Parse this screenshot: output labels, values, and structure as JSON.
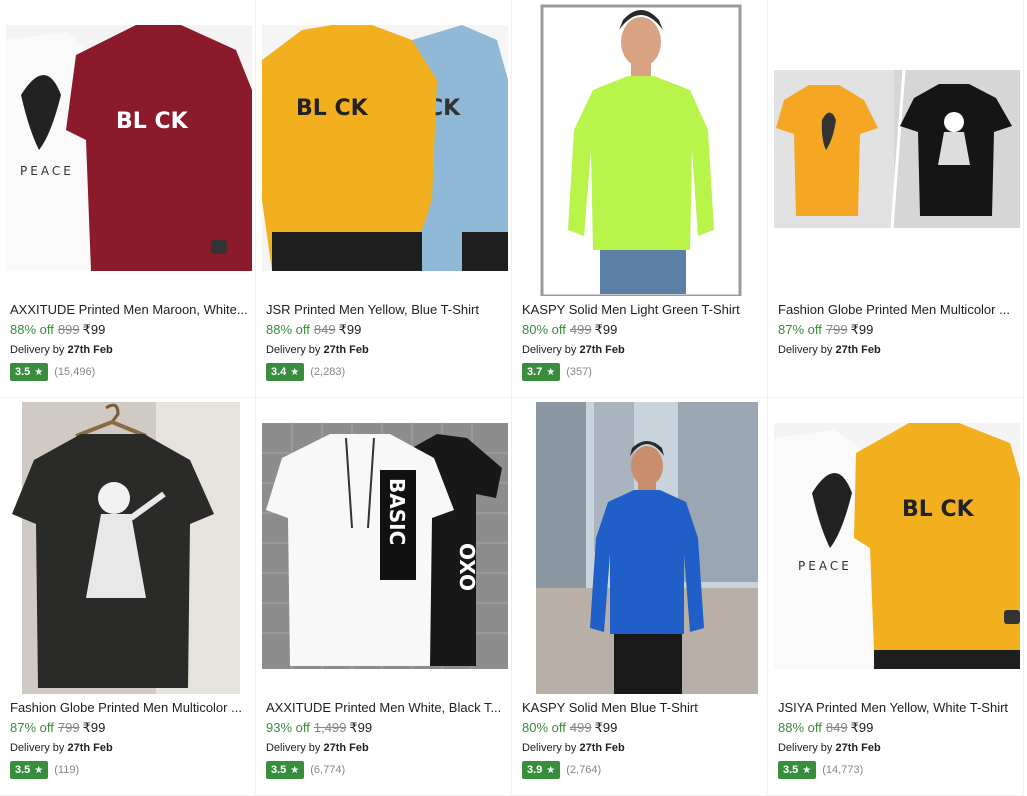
{
  "products": [
    {
      "title": "AXXITUDE Printed Men Maroon, White...",
      "discount": "88% off",
      "mrp": "899",
      "price": "₹99",
      "delivery_prefix": "Delivery by",
      "delivery_date": "27th Feb",
      "rating": "3.5",
      "reviews": "(15,496)",
      "print_text_1": "PEACE",
      "print_text_2": "BL CK"
    },
    {
      "title": "JSR Printed Men Yellow, Blue T-Shirt",
      "discount": "88% off",
      "mrp": "849",
      "price": "₹99",
      "delivery_prefix": "Delivery by",
      "delivery_date": "27th Feb",
      "rating": "3.4",
      "reviews": "(2,283)",
      "print_text_1": "BL CK",
      "print_text_2": "CK"
    },
    {
      "title": "KASPY Solid Men Light Green T-Shirt",
      "discount": "80% off",
      "mrp": "499",
      "price": "₹99",
      "delivery_prefix": "Delivery by",
      "delivery_date": "27th Feb",
      "rating": "3.7",
      "reviews": "(357)"
    },
    {
      "title": "Fashion Globe Printed Men Multicolor ...",
      "discount": "87% off",
      "mrp": "799",
      "price": "₹99",
      "delivery_prefix": "Delivery by",
      "delivery_date": "27th Feb",
      "rating": "",
      "reviews": ""
    },
    {
      "title": "Fashion Globe Printed Men Multicolor ...",
      "discount": "87% off",
      "mrp": "799",
      "price": "₹99",
      "delivery_prefix": "Delivery by",
      "delivery_date": "27th Feb",
      "rating": "3.5",
      "reviews": "(119)"
    },
    {
      "title": "AXXITUDE Printed Men White, Black T...",
      "discount": "93% off",
      "mrp": "1,499",
      "price": "₹99",
      "delivery_prefix": "Delivery by",
      "delivery_date": "27th Feb",
      "rating": "3.5",
      "reviews": "(6,774)",
      "print_text_1": "BASIC",
      "print_text_2": "OXO"
    },
    {
      "title": "KASPY Solid Men Blue T-Shirt",
      "discount": "80% off",
      "mrp": "499",
      "price": "₹99",
      "delivery_prefix": "Delivery by",
      "delivery_date": "27th Feb",
      "rating": "3.9",
      "reviews": "(2,764)"
    },
    {
      "title": "JSIYA Printed Men Yellow, White T-Shirt",
      "discount": "88% off",
      "mrp": "849",
      "price": "₹99",
      "delivery_prefix": "Delivery by",
      "delivery_date": "27th Feb",
      "rating": "3.5",
      "reviews": "(14,773)",
      "print_text_1": "PEACE",
      "print_text_2": "BL CK"
    }
  ],
  "icons": {
    "rating_star": "star-icon"
  },
  "colors": {
    "discount_green": "#388e3c",
    "rating_badge": "#388e3c",
    "muted": "#878787"
  }
}
